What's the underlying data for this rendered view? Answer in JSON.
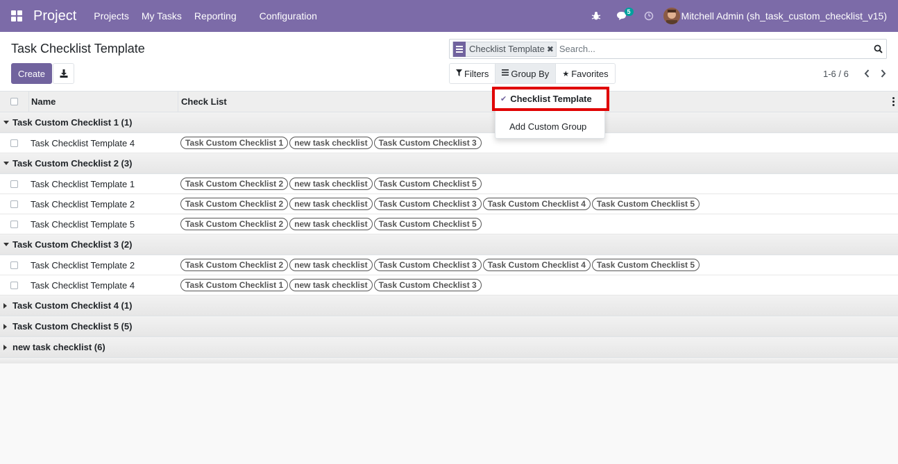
{
  "navbar": {
    "brand": "Project",
    "menu": [
      "Projects",
      "My Tasks",
      "Reporting",
      "Configuration"
    ],
    "messages_badge": "5",
    "user_name": "Mitchell Admin (sh_task_custom_checklist_v15)"
  },
  "control_panel": {
    "title": "Task Checklist Template",
    "create_label": "Create",
    "search": {
      "facet_label": "Checklist Template",
      "placeholder": "Search..."
    },
    "filters_label": "Filters",
    "group_by_label": "Group By",
    "favorites_label": "Favorites",
    "pager": "1-6 / 6"
  },
  "group_by_dropdown": {
    "selected": "Checklist Template",
    "add_custom": "Add Custom Group"
  },
  "list": {
    "columns": [
      "Name",
      "Check List"
    ],
    "groups": [
      {
        "label": "Task Custom Checklist 1 (1)",
        "expanded": true,
        "rows": [
          {
            "name": "Task Checklist Template 4",
            "tags": [
              "Task Custom Checklist 1",
              "new task checklist",
              "Task Custom Checklist 3"
            ]
          }
        ]
      },
      {
        "label": "Task Custom Checklist 2 (3)",
        "expanded": true,
        "rows": [
          {
            "name": "Task Checklist Template 1",
            "tags": [
              "Task Custom Checklist 2",
              "new task checklist",
              "Task Custom Checklist 5"
            ]
          },
          {
            "name": "Task Checklist Template 2",
            "tags": [
              "Task Custom Checklist 2",
              "new task checklist",
              "Task Custom Checklist 3",
              "Task Custom Checklist 4",
              "Task Custom Checklist 5"
            ]
          },
          {
            "name": "Task Checklist Template 5",
            "tags": [
              "Task Custom Checklist 2",
              "new task checklist",
              "Task Custom Checklist 5"
            ]
          }
        ]
      },
      {
        "label": "Task Custom Checklist 3 (2)",
        "expanded": true,
        "rows": [
          {
            "name": "Task Checklist Template 2",
            "tags": [
              "Task Custom Checklist 2",
              "new task checklist",
              "Task Custom Checklist 3",
              "Task Custom Checklist 4",
              "Task Custom Checklist 5"
            ]
          },
          {
            "name": "Task Checklist Template 4",
            "tags": [
              "Task Custom Checklist 1",
              "new task checklist",
              "Task Custom Checklist 3"
            ]
          }
        ]
      },
      {
        "label": "Task Custom Checklist 4 (1)",
        "expanded": false,
        "rows": []
      },
      {
        "label": "Task Custom Checklist 5 (5)",
        "expanded": false,
        "rows": []
      },
      {
        "label": "new task checklist (6)",
        "expanded": false,
        "rows": []
      }
    ]
  },
  "colors": {
    "navbar": "#7c6ba8",
    "primary": "#71639e",
    "highlight_border": "#e00000",
    "badge": "#00a09d"
  }
}
